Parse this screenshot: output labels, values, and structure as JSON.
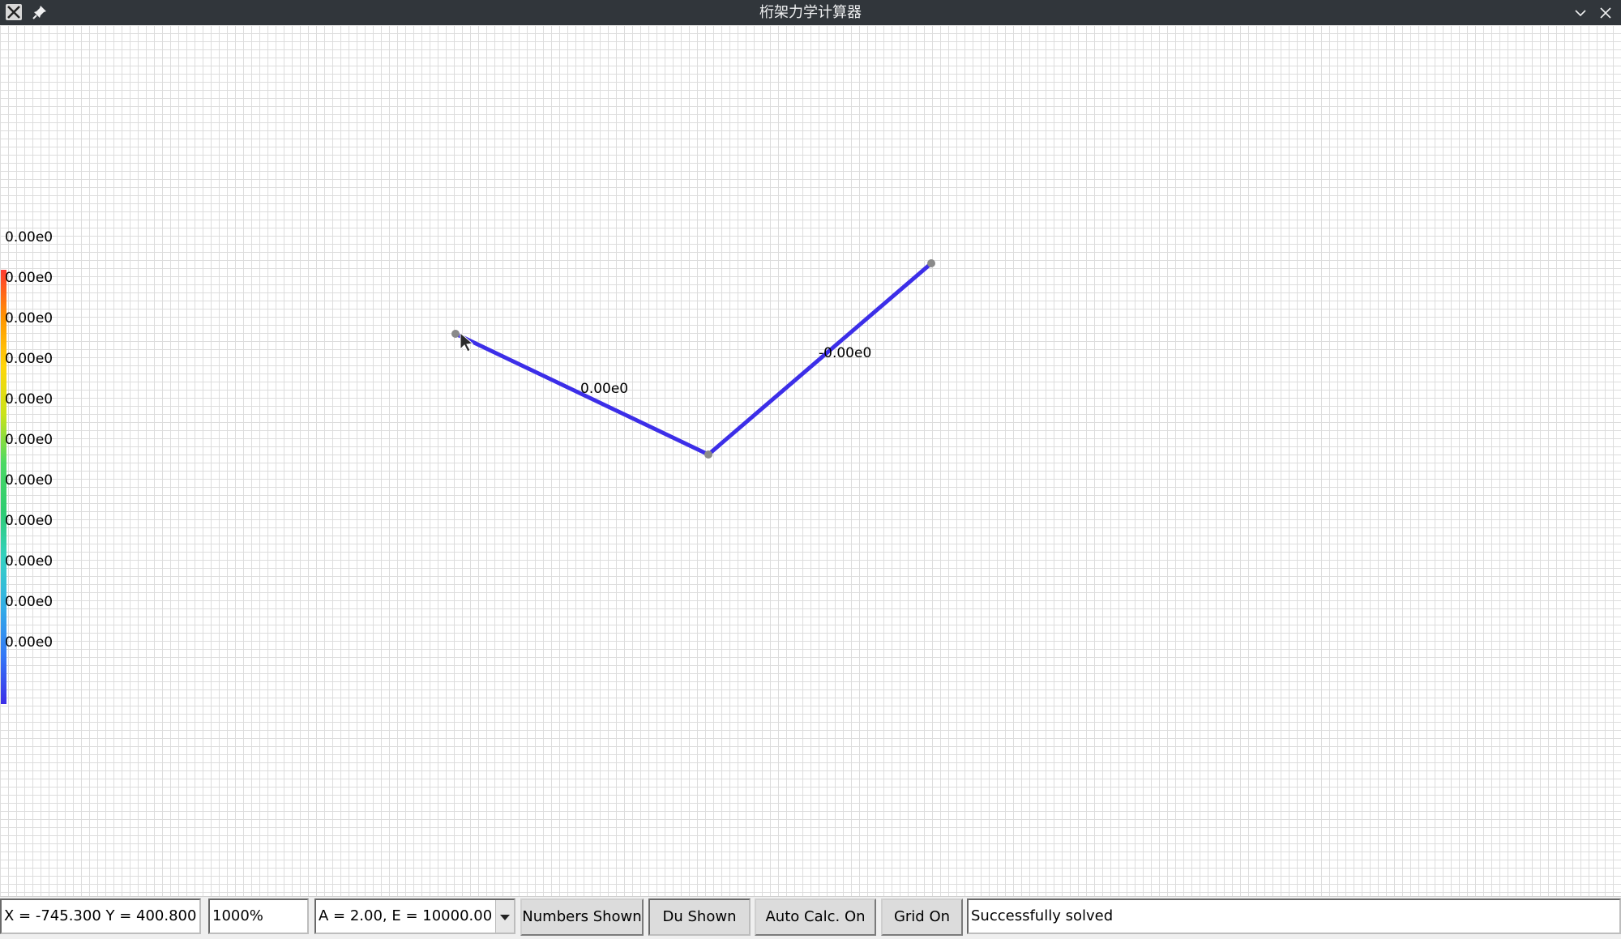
{
  "window": {
    "title": "桁架力学计算器",
    "icons": [
      "x11-app-icon",
      "pin-icon",
      "minimize-chevron-icon",
      "close-icon"
    ]
  },
  "canvas": {
    "grid_on": true,
    "grid_color": "#dddddd",
    "member_color": "#3c2ee8",
    "node_color": "#8a8a8a",
    "members": [
      {
        "label": "0.00e0"
      },
      {
        "label": "-0.00e0"
      }
    ],
    "legend": {
      "labels": [
        "0.00e0",
        "0.00e0",
        "0.00e0",
        "0.00e0",
        "0.00e0",
        "0.00e0",
        "0.00e0",
        "0.00e0",
        "0.00e0",
        "0.00e0",
        "0.00e0"
      ],
      "colors": [
        "#ff3b30",
        "#ff9500",
        "#ffd60a",
        "#c9e31a",
        "#4cd964",
        "#2ecc71",
        "#34d1c4",
        "#32ade6",
        "#3478f6",
        "#3c2ee8"
      ]
    }
  },
  "toolbar": {
    "coordinates": "X = -745.300 Y = 400.800",
    "zoom": "1000%",
    "material": "A = 2.00, E = 10000.00",
    "numbers_label": "Numbers Shown",
    "du_label": "Du Shown",
    "auto_calc_label": "Auto Calc. On",
    "grid_label": "Grid On",
    "status": "Successfully solved"
  }
}
